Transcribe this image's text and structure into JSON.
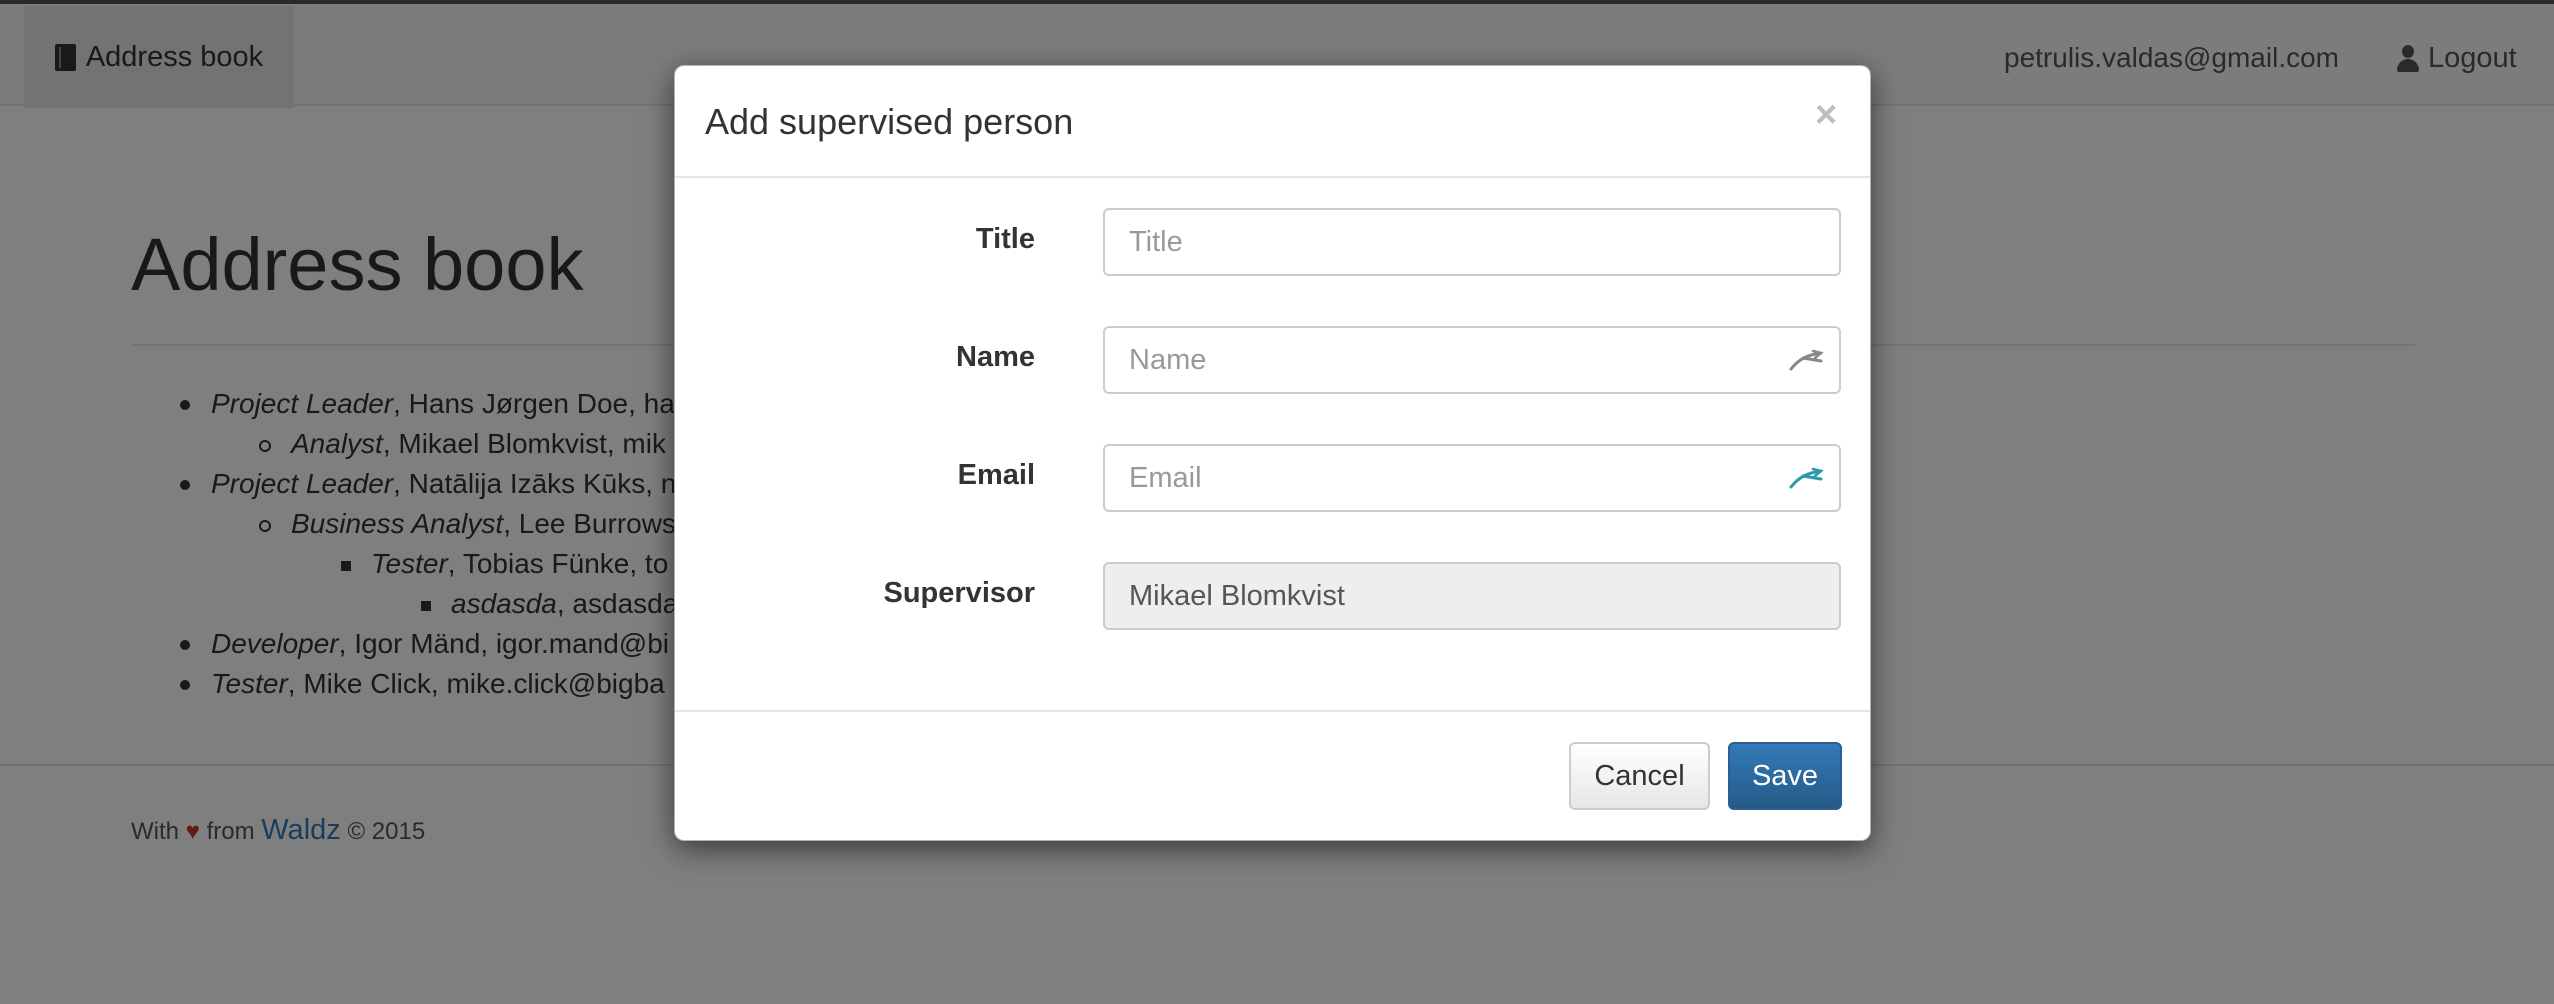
{
  "navbar": {
    "brand_label": "Address book",
    "user_email": "petrulis.valdas@gmail.com",
    "logout_label": "Logout"
  },
  "main": {
    "title": "Address book",
    "people": [
      {
        "role": "Project Leader",
        "text": ", Hans Jørgen Doe, ha"
      },
      {
        "role": "Analyst",
        "text": ", Mikael Blomkvist, mik"
      },
      {
        "role": "Project Leader",
        "text": ", Natālija Izāks Kūks, n"
      },
      {
        "role": "Business Analyst",
        "text": ", Lee Burrows"
      },
      {
        "role": "Tester",
        "text": ", Tobias Fünke, to"
      },
      {
        "role": "asdasda",
        "text": ", asdasda"
      },
      {
        "role": "Developer",
        "text": ", Igor Mänd, igor.mand@bi"
      },
      {
        "role": "Tester",
        "text": ", Mike Click, mike.click@bigba"
      }
    ]
  },
  "footer": {
    "with": "With",
    "heart": "♥",
    "from": "from",
    "author": "Waldz",
    "copyright": "© 2015"
  },
  "modal": {
    "title": "Add supervised person",
    "close_symbol": "×",
    "fields": {
      "title": {
        "label": "Title",
        "placeholder": "Title",
        "value": ""
      },
      "name": {
        "label": "Name",
        "placeholder": "Name",
        "value": ""
      },
      "email": {
        "label": "Email",
        "placeholder": "Email",
        "value": ""
      },
      "supervisor": {
        "label": "Supervisor",
        "value": "Mikael Blomkvist"
      }
    },
    "cancel_label": "Cancel",
    "save_label": "Save"
  },
  "colors": {
    "primary": "#337ab7",
    "heart": "#c0392b",
    "lastpass_icon_gray": "#888888",
    "lastpass_icon_teal": "#2a9ba8"
  }
}
